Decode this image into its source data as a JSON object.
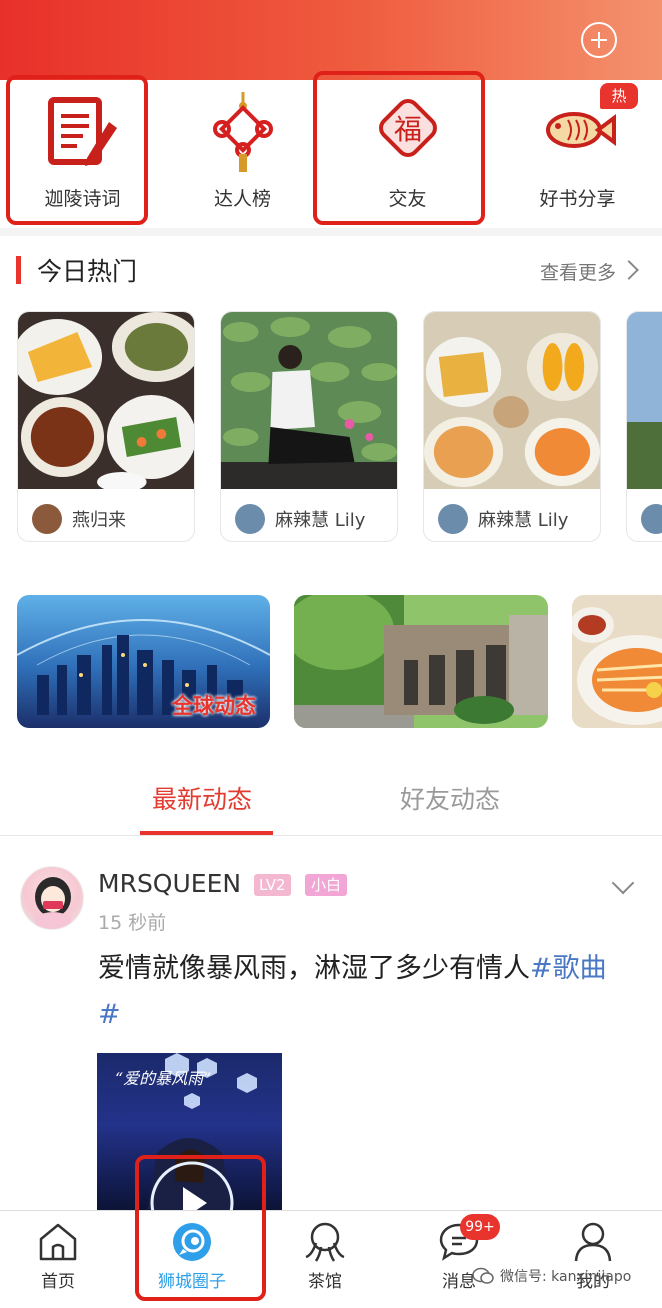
{
  "categories": [
    {
      "label": "迦陵诗词",
      "icon": "document-pen-icon"
    },
    {
      "label": "达人榜",
      "icon": "chinese-knot-icon"
    },
    {
      "label": "交友",
      "icon": "lantern-character-icon"
    },
    {
      "label": "好书分享",
      "icon": "fish-icon"
    }
  ],
  "hot_badge": "热",
  "hot_section": {
    "title": "今日热门",
    "more": "查看更多",
    "cards": [
      {
        "author": "燕归来"
      },
      {
        "author": "麻辣慧 Lily"
      },
      {
        "author": "麻辣慧 Lily"
      }
    ]
  },
  "banners": [
    {
      "text": "全球动态"
    },
    {
      "text": ""
    },
    {
      "text": ""
    }
  ],
  "feed_tabs": {
    "active": "最新动态",
    "inactive": "好友动态"
  },
  "post": {
    "username": "MRSQUEEN",
    "level": "LV2",
    "tag": "小白",
    "time": "15 秒前",
    "text": "爱情就像暴风雨，淋湿了多少有情人",
    "hashtag": "#歌曲#",
    "image_caption": "“爱的暴风雨”"
  },
  "bottom_nav": [
    {
      "label": "首页",
      "icon": "home-icon"
    },
    {
      "label": "狮城圈子",
      "icon": "circle-chat-icon",
      "active": true
    },
    {
      "label": "茶馆",
      "icon": "teahouse-icon"
    },
    {
      "label": "消息",
      "icon": "message-icon",
      "badge": "99+"
    },
    {
      "label": "我的",
      "icon": "user-icon"
    }
  ],
  "watermark": "微信号: kanxinjiapo",
  "colors": {
    "accent": "#e8342d",
    "hashtag": "#4a78c4",
    "active_nav": "#2e9fe8"
  }
}
